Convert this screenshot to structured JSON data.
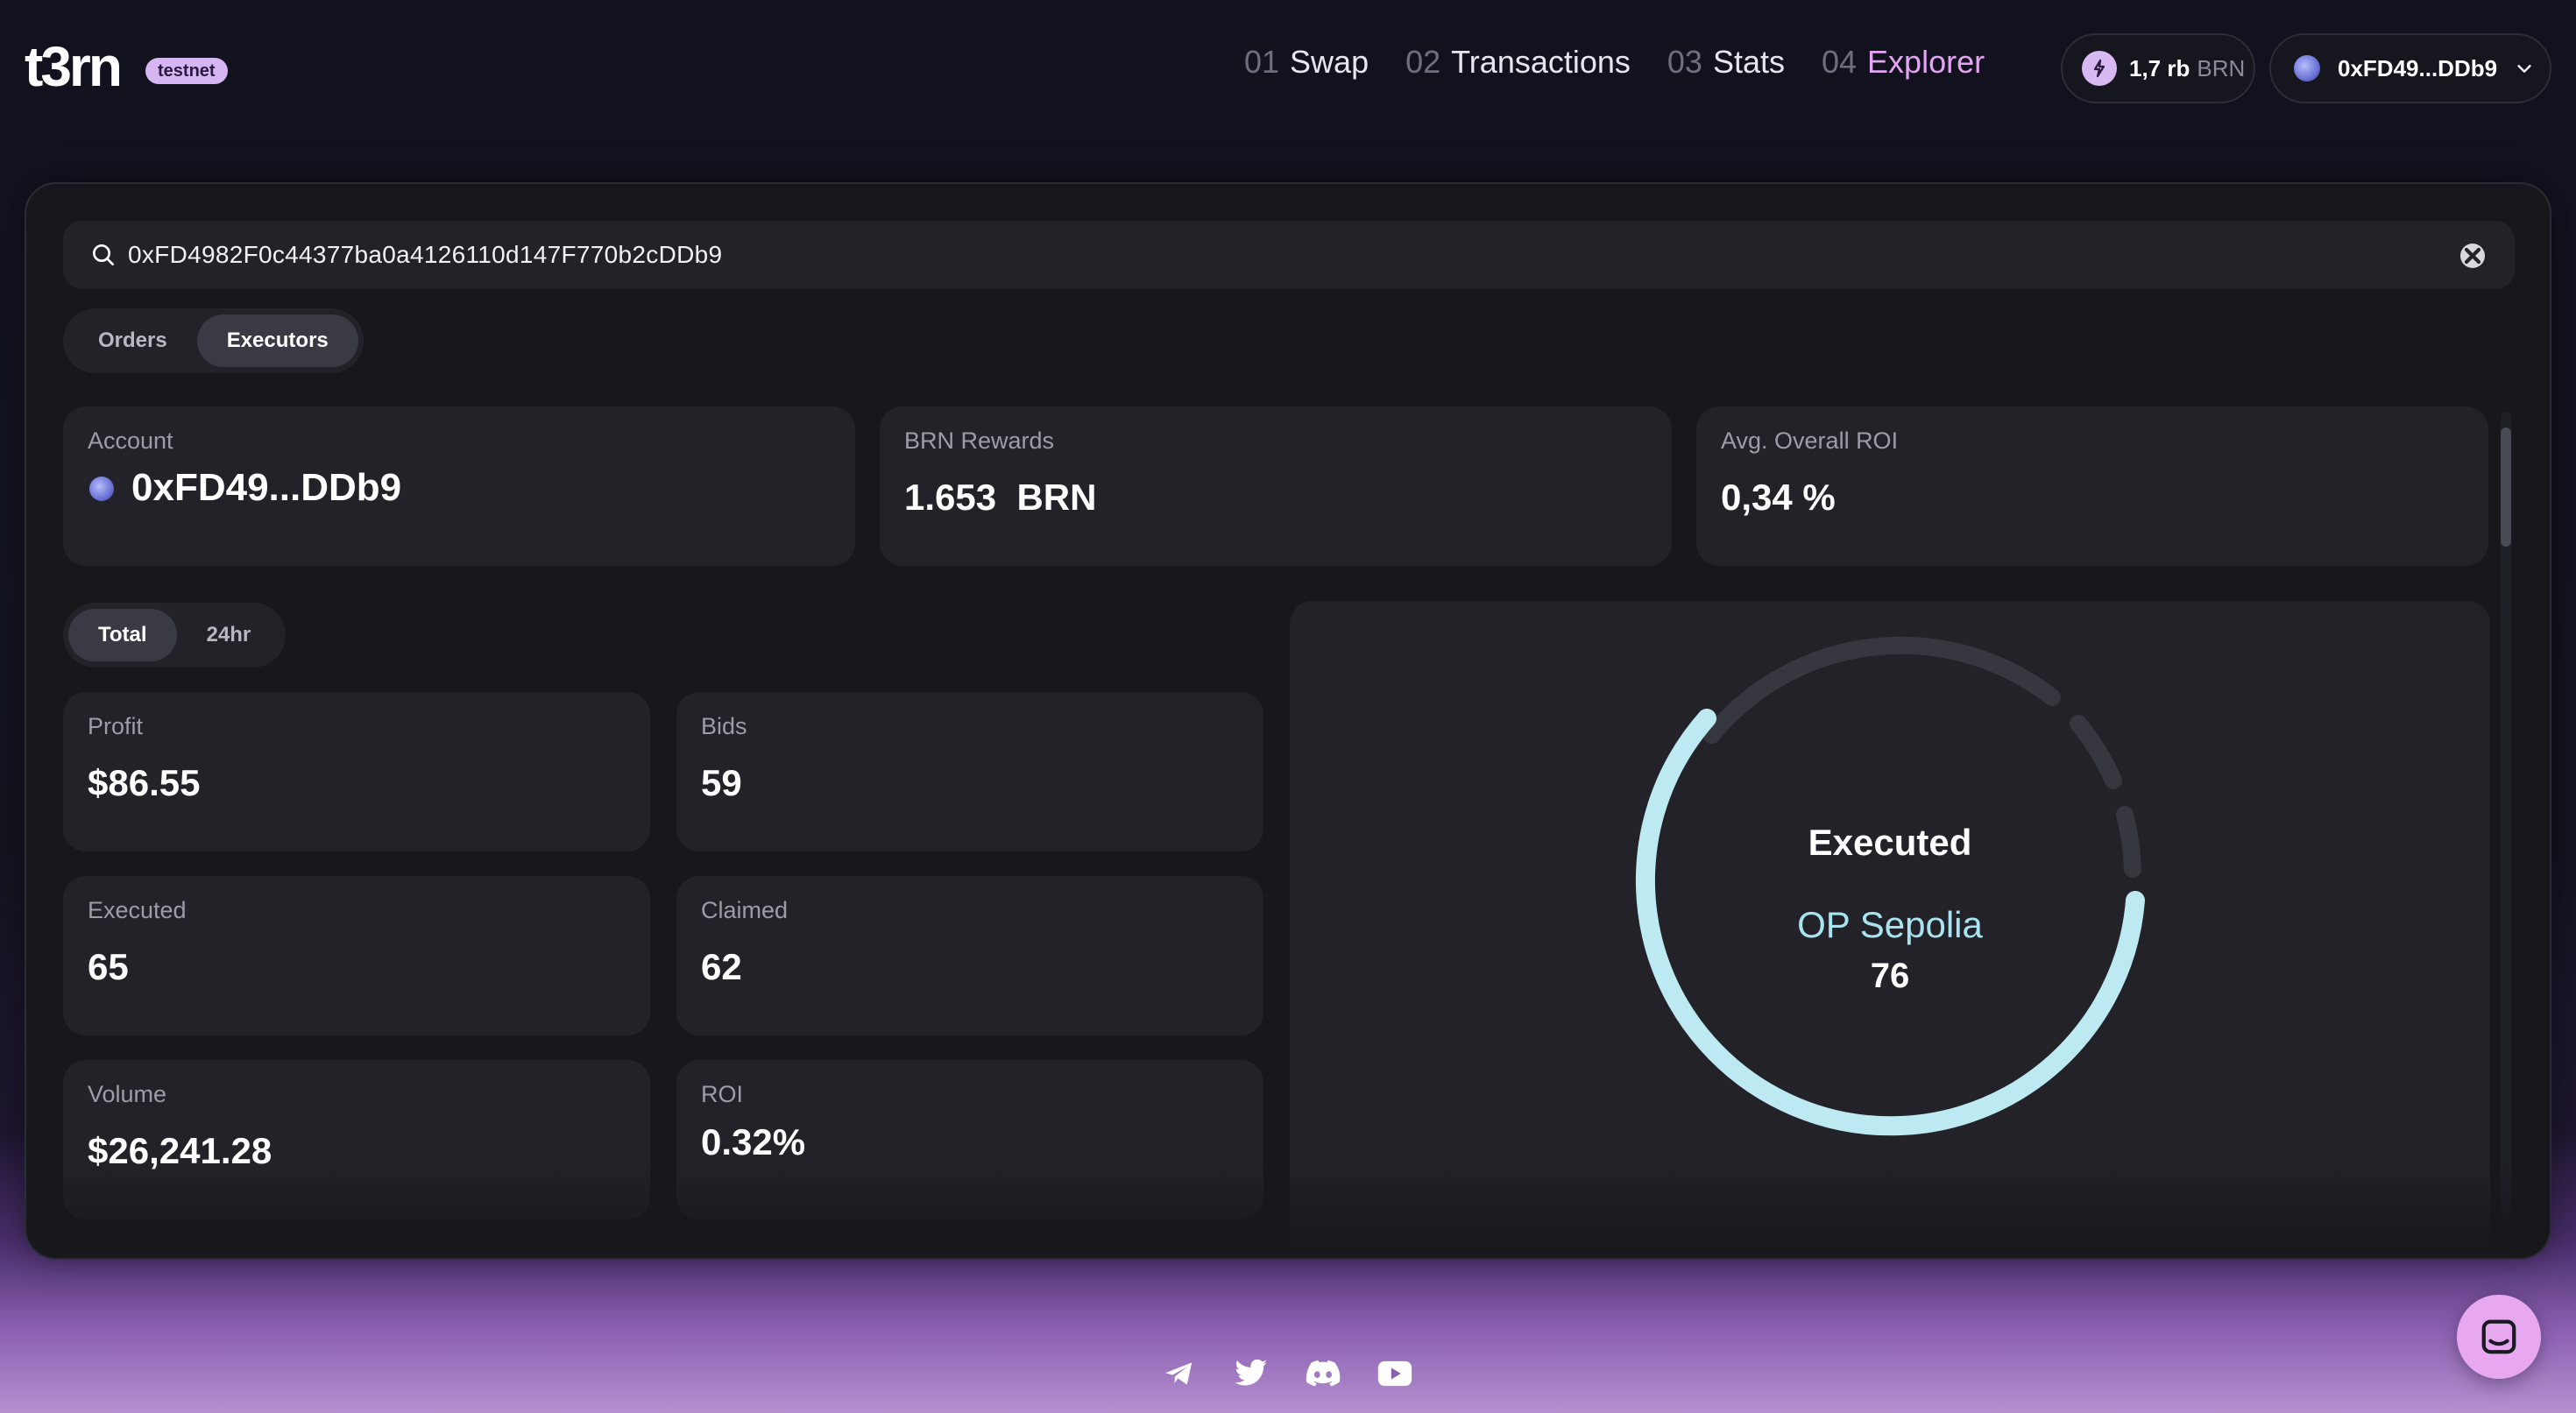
{
  "header": {
    "logo": "t3rn",
    "badge": "testnet",
    "nav": [
      {
        "num": "01",
        "label": "Swap"
      },
      {
        "num": "02",
        "label": "Transactions"
      },
      {
        "num": "03",
        "label": "Stats"
      },
      {
        "num": "04",
        "label": "Explorer"
      }
    ],
    "balance": {
      "value": "1,7 rb",
      "unit": "BRN"
    },
    "wallet": {
      "address": "0xFD49...DDb9"
    }
  },
  "search": {
    "value": "0xFD4982F0c44377ba0a4126110d147F770b2cDDb9"
  },
  "tabs_top": [
    "Orders",
    "Executors"
  ],
  "summary": {
    "account": {
      "label": "Account",
      "value": "0xFD49...DDb9"
    },
    "rewards": {
      "label": "BRN Rewards",
      "value": "1.653  BRN"
    },
    "roi": {
      "label": "Avg. Overall ROI",
      "value": "0,34 %"
    }
  },
  "tabs_period": [
    "Total",
    "24hr"
  ],
  "stats": {
    "profit": {
      "label": "Profit",
      "value": "$86.55"
    },
    "bids": {
      "label": "Bids",
      "value": "59"
    },
    "executed": {
      "label": "Executed",
      "value": "65"
    },
    "claimed": {
      "label": "Claimed",
      "value": "62"
    },
    "volume": {
      "label": "Volume",
      "value": "$26,241.28"
    },
    "roi": {
      "label": "ROI",
      "value": "0.32%"
    }
  },
  "chart_data": {
    "type": "pie",
    "title": "Executed",
    "highlight": {
      "name": "OP Sepolia",
      "value": 76
    },
    "segment_colors": {
      "highlight": "#bde9f3",
      "other": "#37373f"
    }
  },
  "colors": {
    "accent": "#e3a4f2",
    "badge": "#d6b6f2",
    "panel": "#17171c",
    "card": "#222228"
  },
  "footer": {
    "icons": [
      "telegram-icon",
      "twitter-icon",
      "discord-icon",
      "youtube-icon"
    ]
  }
}
